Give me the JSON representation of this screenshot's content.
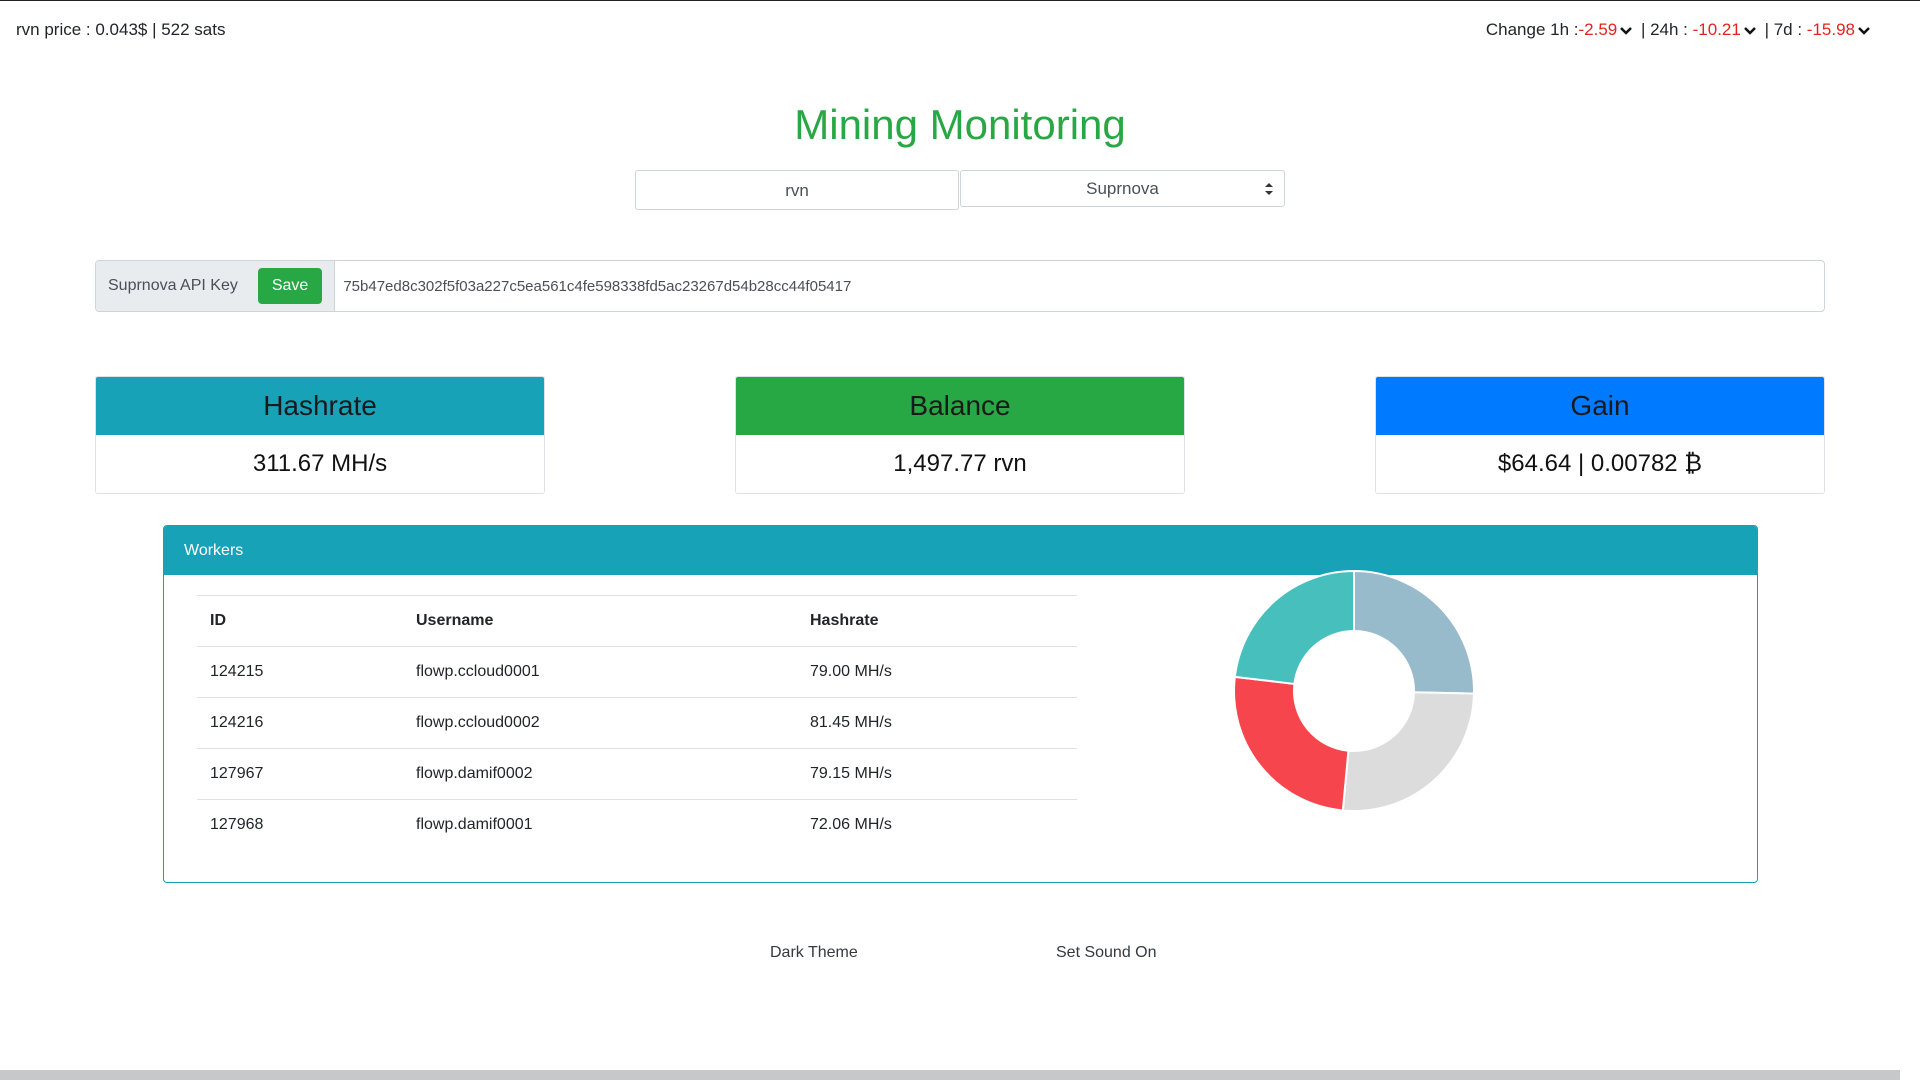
{
  "topbar": {
    "price_text": "rvn price : 0.043$ | 522 sats",
    "change_label": "Change 1h : ",
    "h1": "-2.59",
    "sep24": " | 24h : ",
    "h24": "-10.21",
    "sep7d": " | 7d : ",
    "d7": "-15.98"
  },
  "title": "Mining Monitoring",
  "coin_input": {
    "value": "rvn"
  },
  "pool_select": {
    "selected": "Suprnova"
  },
  "api": {
    "label": "Suprnova API Key",
    "save_label": "Save",
    "key_value": "75b47ed8c302f5f03a227c5ea561c4fe598338fd5ac23267d54b28cc44f05417"
  },
  "cards": [
    {
      "title": "Hashrate",
      "value": "311.67 MH/s",
      "color": "#17a2b8"
    },
    {
      "title": "Balance",
      "value": "1,497.77 rvn",
      "color": "#28a745"
    },
    {
      "title": "Gain",
      "value": "$64.64 | 0.00782 ₿",
      "color": "#007bff"
    }
  ],
  "workers": {
    "header": "Workers",
    "columns": [
      "ID",
      "Username",
      "Hashrate"
    ],
    "rows": [
      [
        "124215",
        "flowp.ccloud0001",
        "79.00 MH/s"
      ],
      [
        "124216",
        "flowp.ccloud0002",
        "81.45 MH/s"
      ],
      [
        "127967",
        "flowp.damif0002",
        "79.15 MH/s"
      ],
      [
        "127968",
        "flowp.damif0001",
        "72.06 MH/s"
      ]
    ]
  },
  "chart_data": {
    "type": "pie",
    "categories": [
      "flowp.ccloud0001",
      "flowp.ccloud0002",
      "flowp.damif0002",
      "flowp.damif0001"
    ],
    "values": [
      79.0,
      81.45,
      79.15,
      72.06
    ],
    "colors": [
      "#98bbcc",
      "#dcdcdc",
      "#f7454e",
      "#47bfbd"
    ],
    "donut": true
  },
  "footer": {
    "dark_theme": "Dark Theme",
    "sound": "Set Sound On"
  }
}
